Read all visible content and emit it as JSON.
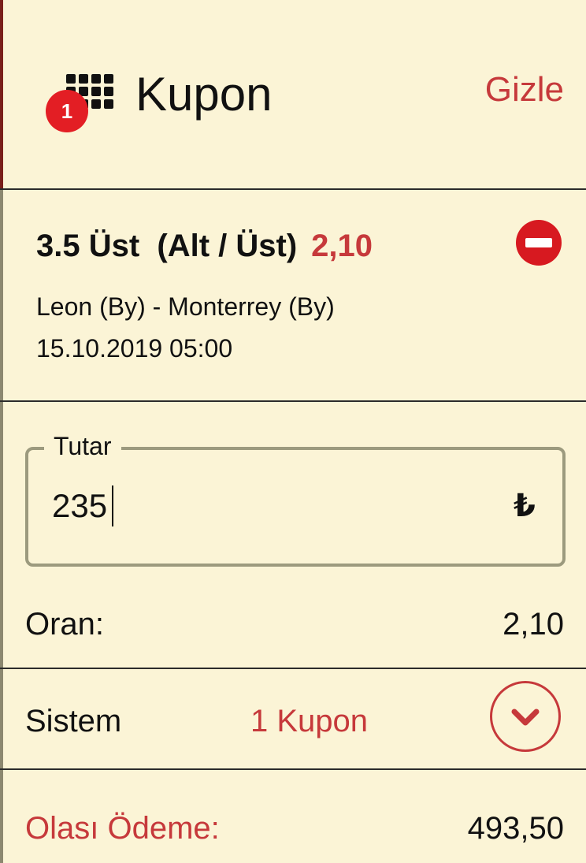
{
  "header": {
    "title": "Kupon",
    "badge_count": "1",
    "hide_label": "Gizle",
    "icon": "grid-icon"
  },
  "bet": {
    "selection": "3.5 Üst  (Alt / Üst)",
    "odds": "2,10",
    "match": "Leon (By) - Monterrey (By)",
    "datetime": "15.10.2019 05:00",
    "remove_icon": "minus-circle-icon"
  },
  "amount": {
    "label": "Tutar",
    "value": "235",
    "currency": "₺"
  },
  "summary": {
    "odds_label": "Oran:",
    "odds_value": "2,10"
  },
  "system": {
    "label": "Sistem",
    "count": "1 Kupon",
    "toggle_icon": "chevron-down-icon"
  },
  "payout": {
    "label": "Olası Ödeme:",
    "value": "493,50"
  },
  "colors": {
    "background": "#fbf4d6",
    "accent": "#c6393b",
    "badge": "#e31e24",
    "remove": "#d71920",
    "border": "#9c9a7e"
  }
}
